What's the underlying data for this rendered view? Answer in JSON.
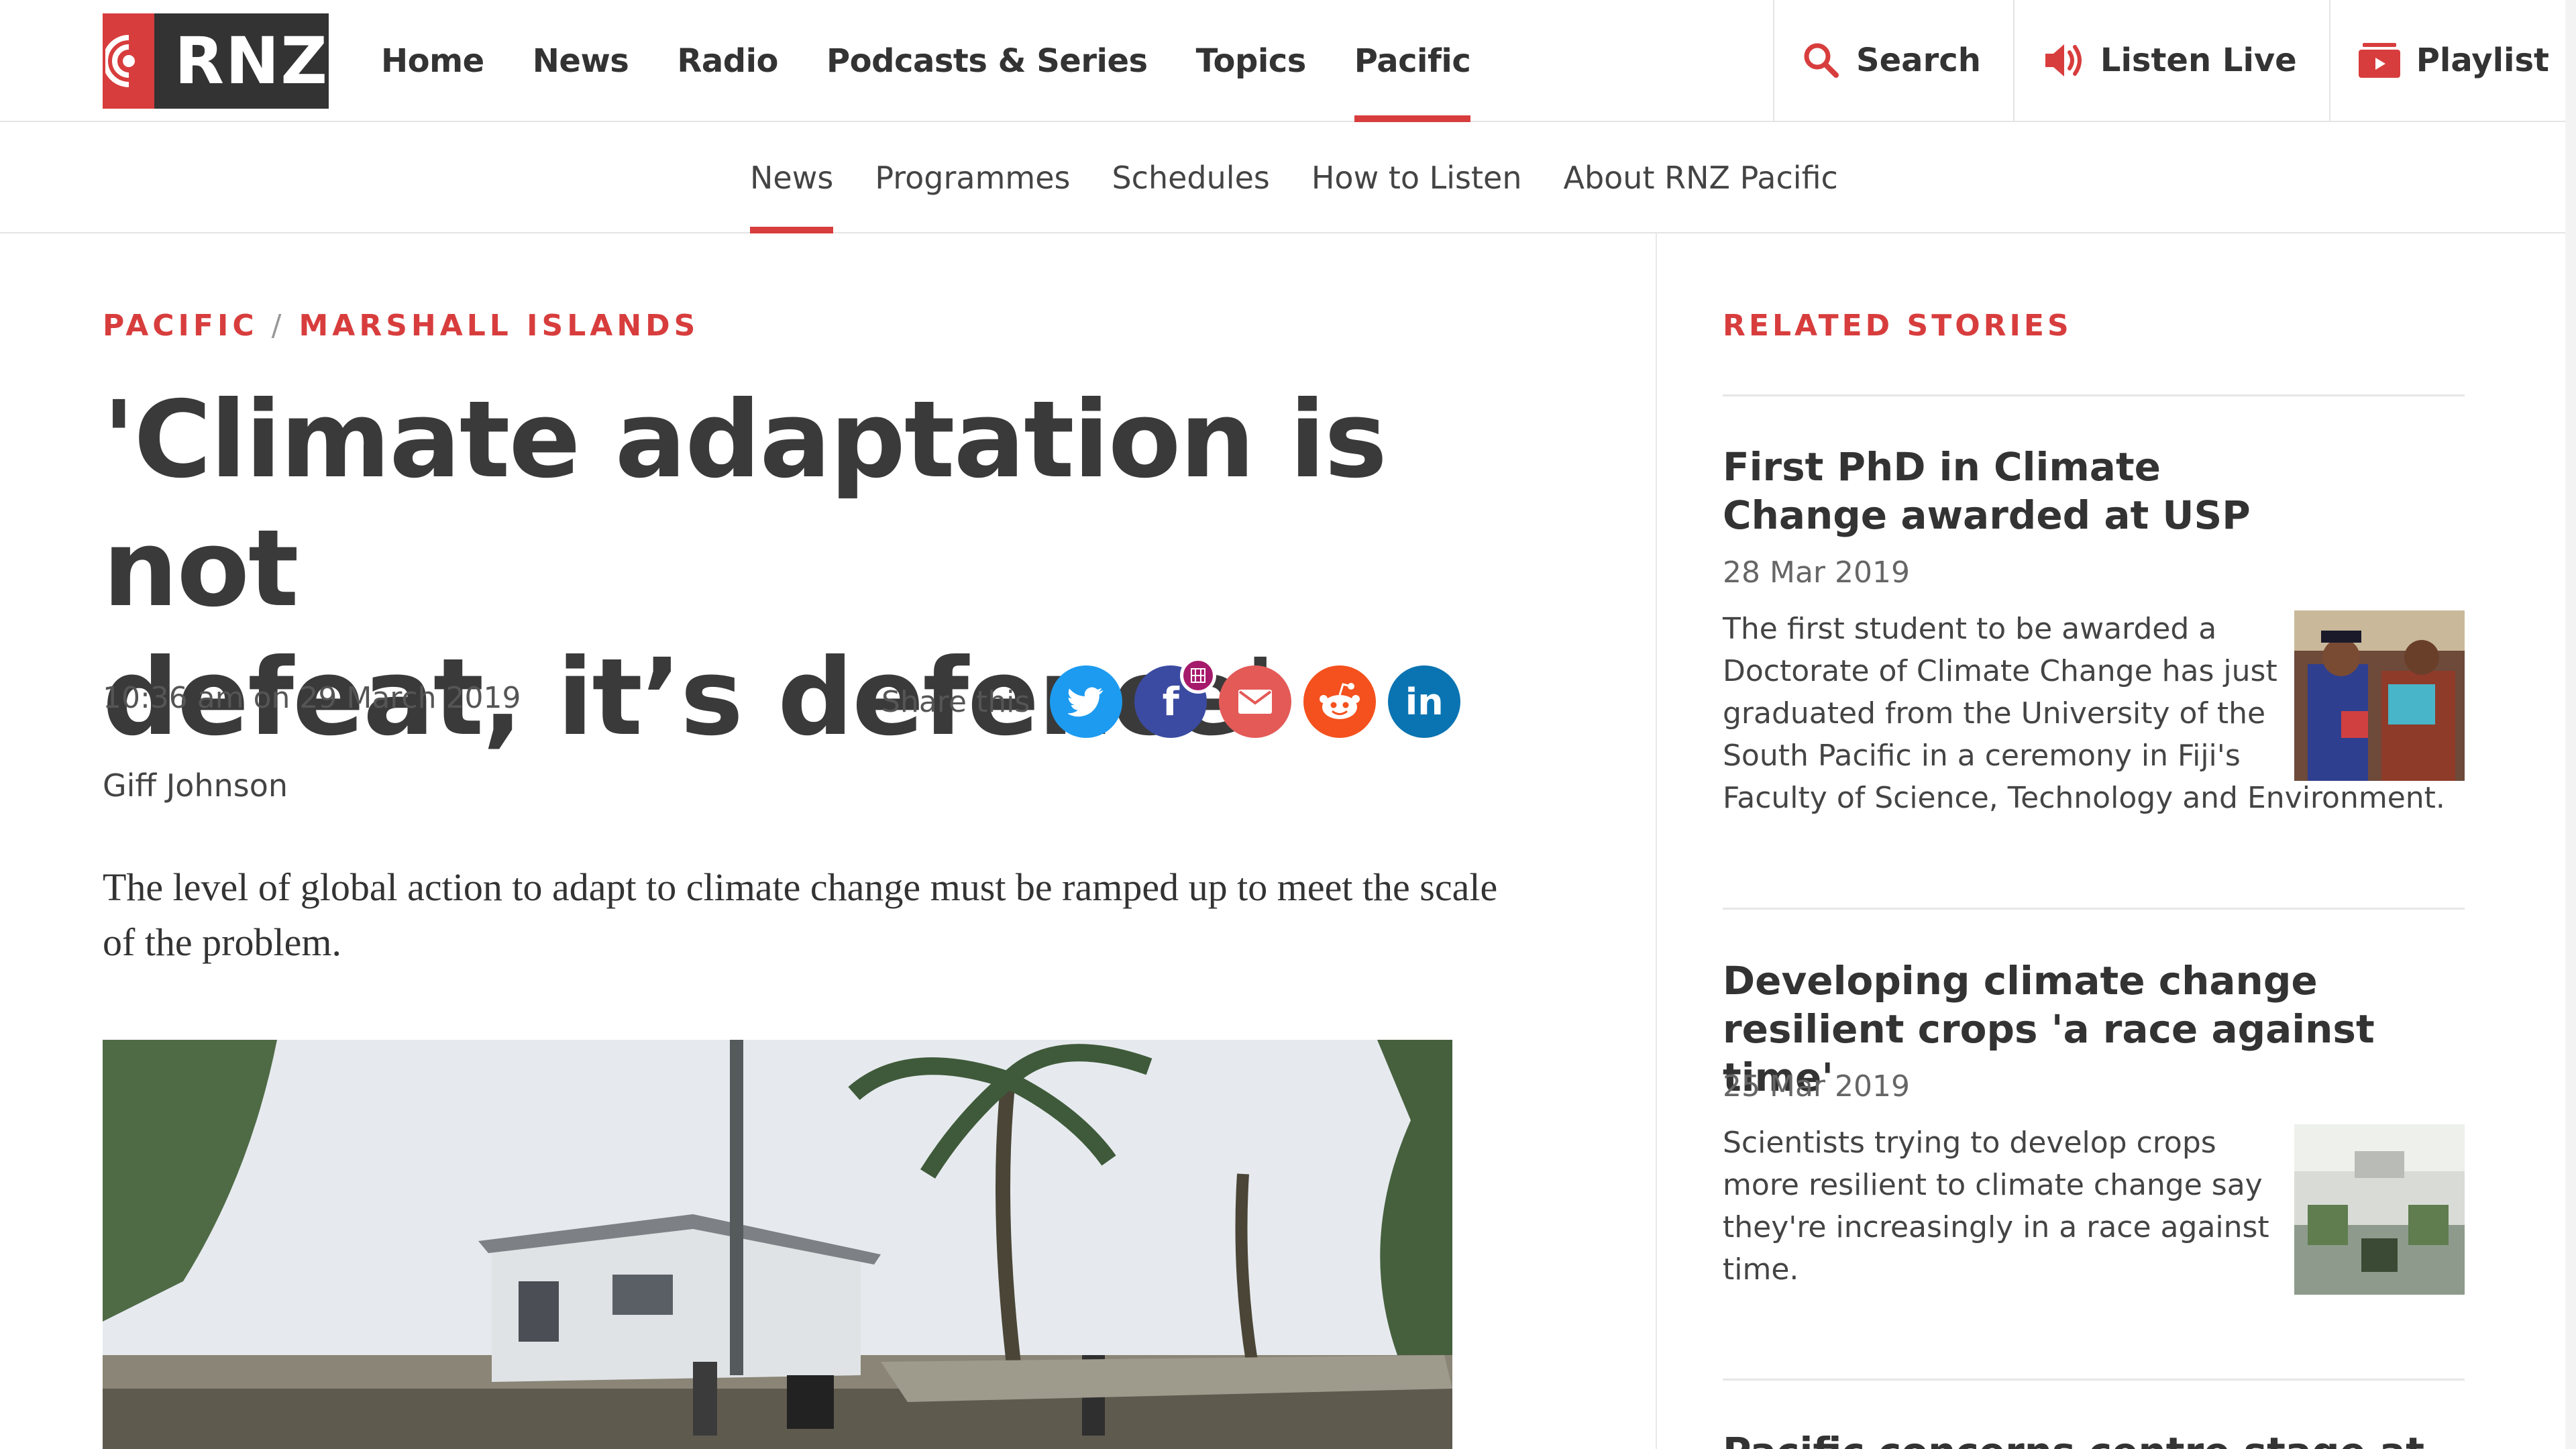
{
  "brand": {
    "logo_text": "RNZ"
  },
  "main_nav": [
    {
      "label": "Home"
    },
    {
      "label": "News"
    },
    {
      "label": "Radio"
    },
    {
      "label": "Podcasts & Series"
    },
    {
      "label": "Topics"
    },
    {
      "label": "Pacific",
      "active": true
    }
  ],
  "tools": {
    "search": "Search",
    "listen_live": "Listen Live",
    "playlist": "Playlist"
  },
  "sub_nav": [
    {
      "label": "News",
      "active": true
    },
    {
      "label": "Programmes"
    },
    {
      "label": "Schedules"
    },
    {
      "label": "How to Listen"
    },
    {
      "label": "About RNZ Pacific"
    }
  ],
  "article": {
    "kicker_section": "PACIFIC",
    "kicker_separator": "/",
    "kicker_region": "MARSHALL ISLANDS",
    "headline_line1": "'Climate adaptation is not",
    "headline_line2": "defeat, it’s defence'",
    "dateline": "10:36 am on 29 March 2019",
    "share_label": "Share this",
    "byline": "Giff Johnson",
    "lede": "The level of global action to adapt to climate change must be ramped up to meet the scale of the problem."
  },
  "share_icons": [
    "twitter-icon",
    "facebook-icon",
    "email-icon",
    "reddit-icon",
    "linkedin-icon"
  ],
  "related": {
    "title": "RELATED STORIES",
    "stories": [
      {
        "headline": "First PhD in Climate Change awarded at USP",
        "date": "28 Mar 2019",
        "summary_lines": [
          "The first student to be awarded a",
          "Doctorate of Climate Change has just",
          "graduated from the University of the",
          "South Pacific in a ceremony in Fiji's",
          "Faculty of Science, Technology and Environment."
        ]
      },
      {
        "headline": "Developing climate change resilient crops 'a race against time'",
        "date": "25 Mar 2019",
        "summary_lines": [
          "Scientists trying to develop crops",
          "more resilient to climate change say",
          "they're increasingly in a race against",
          "time."
        ]
      },
      {
        "headline": "Pacific concerns centre stage at"
      }
    ]
  },
  "colors": {
    "accent": "#d83d3d",
    "text_dark": "#333333",
    "logo_bg": "#333333",
    "twitter": "#1d9bf0",
    "facebook": "#3b4ba1",
    "email": "#e35a57",
    "reddit": "#f4511e",
    "linkedin": "#0a74b2"
  }
}
